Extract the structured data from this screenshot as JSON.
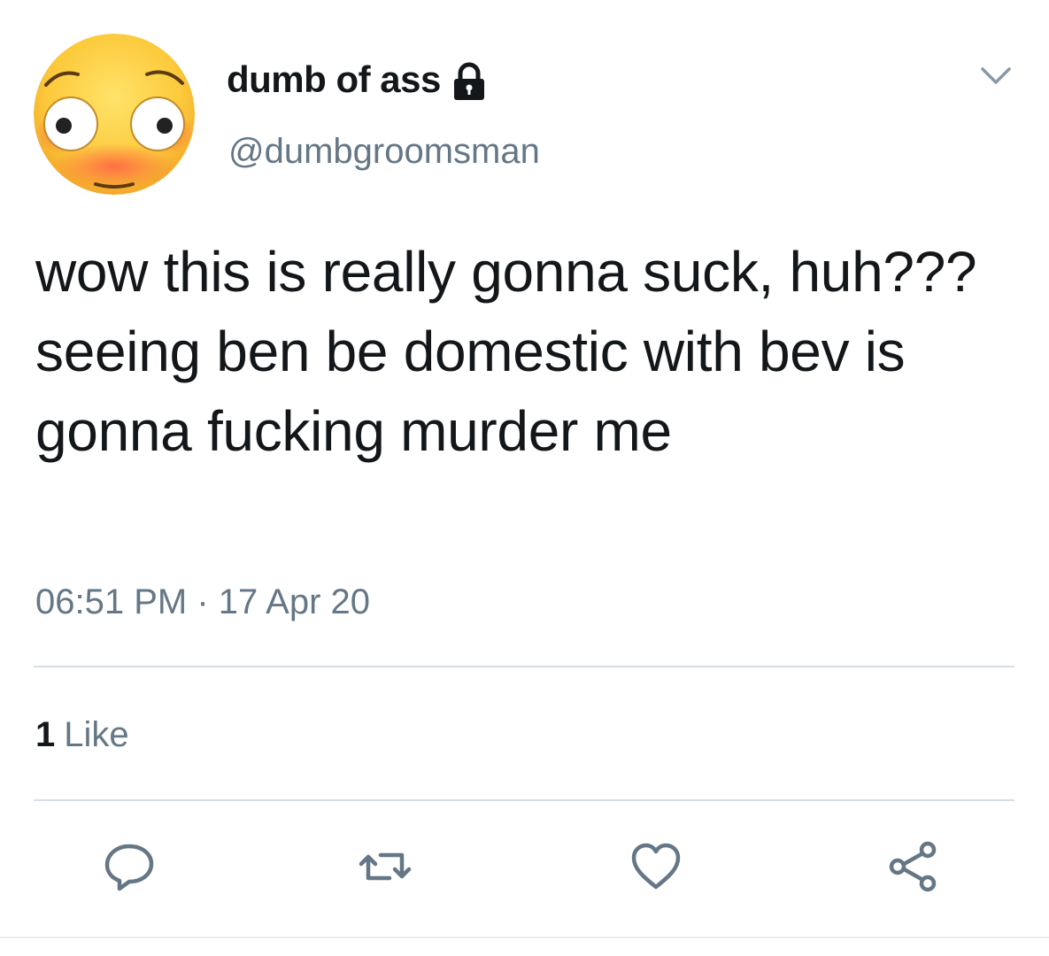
{
  "user": {
    "display_name": "dumb of ass",
    "handle": "@dumbgroomsman",
    "avatar_icon": "flushed-face-avatar",
    "protected_icon": "lock-icon"
  },
  "tweet": {
    "text": "wow this is really gonna suck, huh??? seeing ben be domestic with bev is gonna fucking murder me",
    "timestamp": "06:51 PM · 17 Apr 20"
  },
  "stats": {
    "likes_count": "1",
    "likes_label": "Like"
  },
  "actions": {
    "reply_icon": "reply-icon",
    "retweet_icon": "retweet-icon",
    "like_icon": "heart-icon",
    "share_icon": "share-icon",
    "menu_icon": "chevron-down-icon"
  },
  "colors": {
    "text_primary": "#14171a",
    "text_secondary": "#657786",
    "divider": "#d6dde3",
    "icon": "#657786"
  }
}
